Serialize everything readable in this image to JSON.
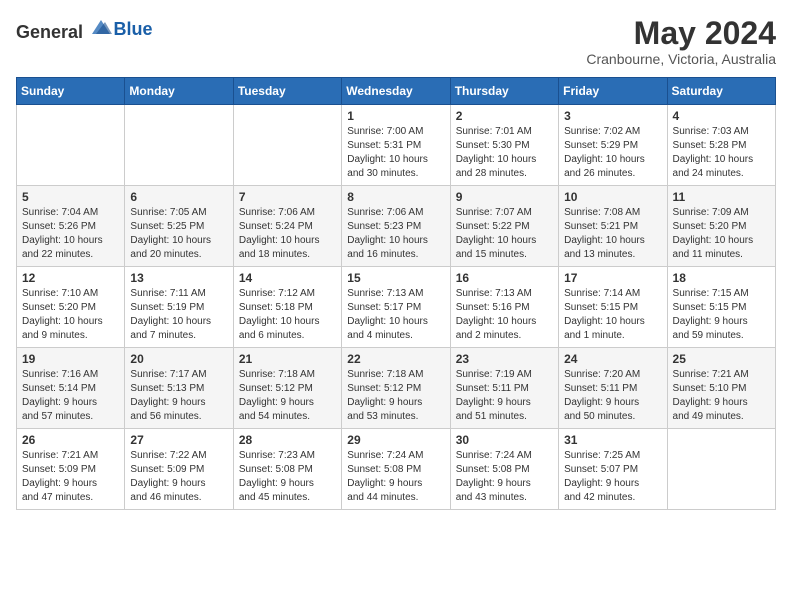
{
  "header": {
    "logo": {
      "general": "General",
      "blue": "Blue"
    },
    "title": "May 2024",
    "location": "Cranbourne, Victoria, Australia"
  },
  "weekdays": [
    "Sunday",
    "Monday",
    "Tuesday",
    "Wednesday",
    "Thursday",
    "Friday",
    "Saturday"
  ],
  "weeks": [
    [
      {
        "day": "",
        "info": ""
      },
      {
        "day": "",
        "info": ""
      },
      {
        "day": "",
        "info": ""
      },
      {
        "day": "1",
        "info": "Sunrise: 7:00 AM\nSunset: 5:31 PM\nDaylight: 10 hours\nand 30 minutes."
      },
      {
        "day": "2",
        "info": "Sunrise: 7:01 AM\nSunset: 5:30 PM\nDaylight: 10 hours\nand 28 minutes."
      },
      {
        "day": "3",
        "info": "Sunrise: 7:02 AM\nSunset: 5:29 PM\nDaylight: 10 hours\nand 26 minutes."
      },
      {
        "day": "4",
        "info": "Sunrise: 7:03 AM\nSunset: 5:28 PM\nDaylight: 10 hours\nand 24 minutes."
      }
    ],
    [
      {
        "day": "5",
        "info": "Sunrise: 7:04 AM\nSunset: 5:26 PM\nDaylight: 10 hours\nand 22 minutes."
      },
      {
        "day": "6",
        "info": "Sunrise: 7:05 AM\nSunset: 5:25 PM\nDaylight: 10 hours\nand 20 minutes."
      },
      {
        "day": "7",
        "info": "Sunrise: 7:06 AM\nSunset: 5:24 PM\nDaylight: 10 hours\nand 18 minutes."
      },
      {
        "day": "8",
        "info": "Sunrise: 7:06 AM\nSunset: 5:23 PM\nDaylight: 10 hours\nand 16 minutes."
      },
      {
        "day": "9",
        "info": "Sunrise: 7:07 AM\nSunset: 5:22 PM\nDaylight: 10 hours\nand 15 minutes."
      },
      {
        "day": "10",
        "info": "Sunrise: 7:08 AM\nSunset: 5:21 PM\nDaylight: 10 hours\nand 13 minutes."
      },
      {
        "day": "11",
        "info": "Sunrise: 7:09 AM\nSunset: 5:20 PM\nDaylight: 10 hours\nand 11 minutes."
      }
    ],
    [
      {
        "day": "12",
        "info": "Sunrise: 7:10 AM\nSunset: 5:20 PM\nDaylight: 10 hours\nand 9 minutes."
      },
      {
        "day": "13",
        "info": "Sunrise: 7:11 AM\nSunset: 5:19 PM\nDaylight: 10 hours\nand 7 minutes."
      },
      {
        "day": "14",
        "info": "Sunrise: 7:12 AM\nSunset: 5:18 PM\nDaylight: 10 hours\nand 6 minutes."
      },
      {
        "day": "15",
        "info": "Sunrise: 7:13 AM\nSunset: 5:17 PM\nDaylight: 10 hours\nand 4 minutes."
      },
      {
        "day": "16",
        "info": "Sunrise: 7:13 AM\nSunset: 5:16 PM\nDaylight: 10 hours\nand 2 minutes."
      },
      {
        "day": "17",
        "info": "Sunrise: 7:14 AM\nSunset: 5:15 PM\nDaylight: 10 hours\nand 1 minute."
      },
      {
        "day": "18",
        "info": "Sunrise: 7:15 AM\nSunset: 5:15 PM\nDaylight: 9 hours\nand 59 minutes."
      }
    ],
    [
      {
        "day": "19",
        "info": "Sunrise: 7:16 AM\nSunset: 5:14 PM\nDaylight: 9 hours\nand 57 minutes."
      },
      {
        "day": "20",
        "info": "Sunrise: 7:17 AM\nSunset: 5:13 PM\nDaylight: 9 hours\nand 56 minutes."
      },
      {
        "day": "21",
        "info": "Sunrise: 7:18 AM\nSunset: 5:12 PM\nDaylight: 9 hours\nand 54 minutes."
      },
      {
        "day": "22",
        "info": "Sunrise: 7:18 AM\nSunset: 5:12 PM\nDaylight: 9 hours\nand 53 minutes."
      },
      {
        "day": "23",
        "info": "Sunrise: 7:19 AM\nSunset: 5:11 PM\nDaylight: 9 hours\nand 51 minutes."
      },
      {
        "day": "24",
        "info": "Sunrise: 7:20 AM\nSunset: 5:11 PM\nDaylight: 9 hours\nand 50 minutes."
      },
      {
        "day": "25",
        "info": "Sunrise: 7:21 AM\nSunset: 5:10 PM\nDaylight: 9 hours\nand 49 minutes."
      }
    ],
    [
      {
        "day": "26",
        "info": "Sunrise: 7:21 AM\nSunset: 5:09 PM\nDaylight: 9 hours\nand 47 minutes."
      },
      {
        "day": "27",
        "info": "Sunrise: 7:22 AM\nSunset: 5:09 PM\nDaylight: 9 hours\nand 46 minutes."
      },
      {
        "day": "28",
        "info": "Sunrise: 7:23 AM\nSunset: 5:08 PM\nDaylight: 9 hours\nand 45 minutes."
      },
      {
        "day": "29",
        "info": "Sunrise: 7:24 AM\nSunset: 5:08 PM\nDaylight: 9 hours\nand 44 minutes."
      },
      {
        "day": "30",
        "info": "Sunrise: 7:24 AM\nSunset: 5:08 PM\nDaylight: 9 hours\nand 43 minutes."
      },
      {
        "day": "31",
        "info": "Sunrise: 7:25 AM\nSunset: 5:07 PM\nDaylight: 9 hours\nand 42 minutes."
      },
      {
        "day": "",
        "info": ""
      }
    ]
  ]
}
